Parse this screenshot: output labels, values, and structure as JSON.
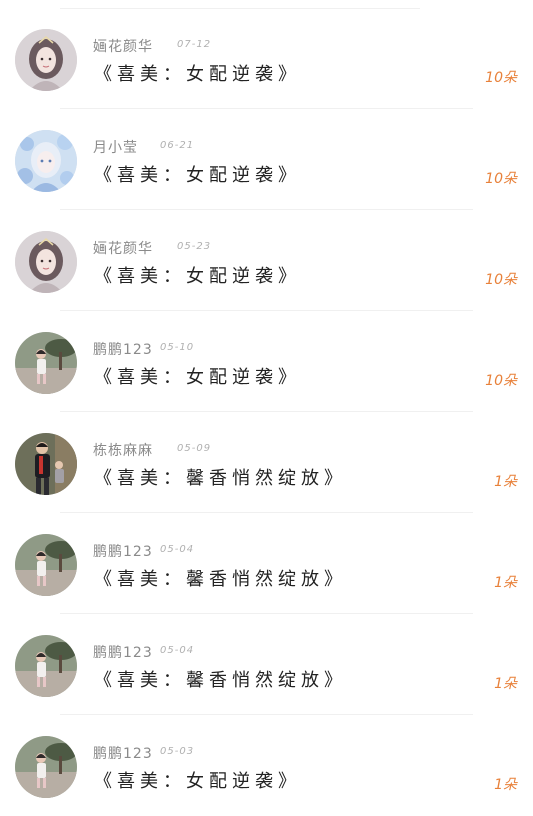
{
  "gifts": [
    {
      "user": "婳花颜华",
      "date": "07-12",
      "book": "《喜美：女配逆袭》",
      "amount": "10朵",
      "avatar": "avatar-girl-illustration"
    },
    {
      "user": "月小莹",
      "date": "06-21",
      "book": "《喜美：女配逆袭》",
      "amount": "10朵",
      "avatar": "avatar-blue-flowers-girl"
    },
    {
      "user": "婳花颜华",
      "date": "05-23",
      "book": "《喜美：女配逆袭》",
      "amount": "10朵",
      "avatar": "avatar-girl-illustration"
    },
    {
      "user": "鹏鹏123",
      "date": "05-10",
      "book": "《喜美：女配逆袭》",
      "amount": "10朵",
      "avatar": "avatar-child-photo"
    },
    {
      "user": "栋栋麻麻",
      "date": "05-09",
      "book": "《喜美：馨香悄然绽放》",
      "amount": "1朵",
      "avatar": "avatar-family-photo"
    },
    {
      "user": "鹏鹏123",
      "date": "05-04",
      "book": "《喜美：馨香悄然绽放》",
      "amount": "1朵",
      "avatar": "avatar-child-photo"
    },
    {
      "user": "鹏鹏123",
      "date": "05-04",
      "book": "《喜美：馨香悄然绽放》",
      "amount": "1朵",
      "avatar": "avatar-child-photo"
    },
    {
      "user": "鹏鹏123",
      "date": "05-03",
      "book": "《喜美：女配逆袭》",
      "amount": "1朵",
      "avatar": "avatar-child-photo"
    }
  ],
  "colors": {
    "amount": "#e8813a",
    "name": "#8a8a8a",
    "date": "#b0b0b0",
    "title": "#222222"
  }
}
